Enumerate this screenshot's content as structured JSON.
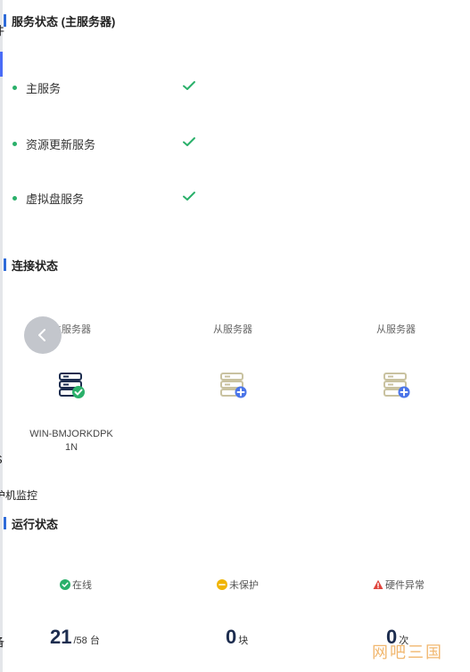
{
  "edge_fragments": {
    "top": "件",
    "side": "S",
    "monitor": "护机监控",
    "bottom": "备"
  },
  "service_status": {
    "title": "服务状态 (主服务器)",
    "items": [
      {
        "label": "主服务",
        "status": "ok"
      },
      {
        "label": "资源更新服务",
        "status": "ok"
      },
      {
        "label": "虚拟盘服务",
        "status": "ok"
      }
    ]
  },
  "connection_status": {
    "title": "连接状态",
    "servers": [
      {
        "role": "主服务器",
        "name_line1": "WIN-BMJORKDPK",
        "name_line2": "1N",
        "state": "connected"
      },
      {
        "role": "从服务器",
        "state": "add"
      },
      {
        "role": "从服务器",
        "state": "add"
      }
    ]
  },
  "run_status": {
    "title": "运行状态",
    "online": {
      "label": "在线",
      "value": "21",
      "suffix": "/58 台"
    },
    "unprotected": {
      "label": "未保护",
      "value": "0",
      "suffix": "块"
    },
    "hardware": {
      "label": "硬件异常",
      "value": "0",
      "suffix": "次"
    }
  },
  "watermark": "网吧三国",
  "colors": {
    "ok": "#2ab06a",
    "accent": "#2f6bd8",
    "warn": "#f0b400",
    "error": "#e0443c"
  }
}
